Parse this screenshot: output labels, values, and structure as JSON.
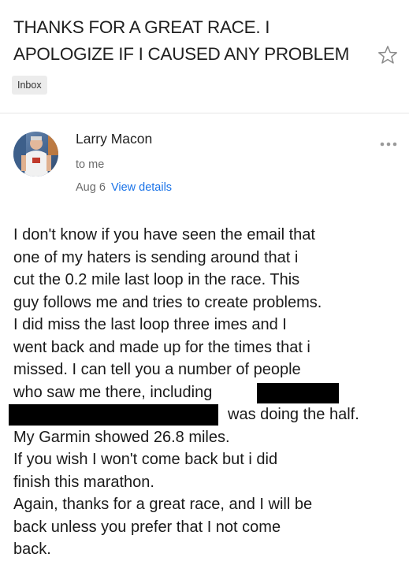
{
  "email": {
    "subject_line1": "THANKS FOR A GREAT RACE. I",
    "subject_line2": "APOLOGIZE IF I CAUSED ANY PROBLEM",
    "label": "Inbox",
    "sender_name": "Larry Macon",
    "recipient": "to me",
    "date": "Aug 6",
    "view_details": "View details",
    "star_icon": "star-outline-icon",
    "more_icon": "more-horizontal-icon",
    "body_lines": [
      "I don't know if you have seen the email that",
      "one of my haters is sending around that i",
      "cut the  0.2 mile last loop in the race. This",
      "guy follows me and tries to create problems.",
      "I did miss the last loop three imes and I",
      "went back and made up for the times that i",
      "missed. I can tell you a number of people",
      "who saw me there, including",
      "was doing the half.",
      "My Garmin showed 26.8 miles.",
      "If you wish I won't come back but i did",
      "finish this marathon.",
      "Again, thanks for a great race, and I will be",
      "back unless you prefer that I not come",
      "back."
    ]
  },
  "colors": {
    "link": "#1a73e8",
    "meta_text": "#6b6b6b",
    "chip_bg": "#ececec",
    "redaction": "#000000"
  }
}
